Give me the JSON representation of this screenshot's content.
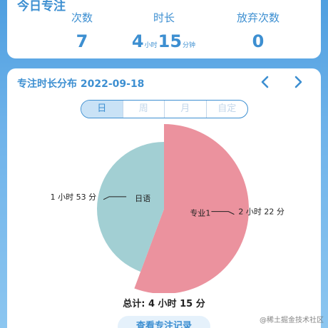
{
  "stats": {
    "title": "今日专注",
    "count_label": "次数",
    "count_value": "7",
    "duration_label": "时长",
    "duration_hours": "4",
    "duration_hours_unit": "小时",
    "duration_minutes": "15",
    "duration_minutes_unit": "分钟",
    "abandon_label": "放弃次数",
    "abandon_value": "0"
  },
  "distribution": {
    "title": "专注时长分布 2022-09-18",
    "prev_icon": "chevron-left-icon",
    "next_icon": "chevron-right-icon",
    "tabs": [
      {
        "label": "日",
        "active": true
      },
      {
        "label": "周",
        "active": false
      },
      {
        "label": "月",
        "active": false
      },
      {
        "label": "自定",
        "active": false
      }
    ],
    "total_label": "总计: 4 小时 15 分",
    "view_records_label": "查看专注记录"
  },
  "chart_data": {
    "type": "pie",
    "rose": true,
    "slices": [
      {
        "name": "专业1",
        "value_minutes": 142,
        "value_label": "2 小时 22 分",
        "color": "#eb929e"
      },
      {
        "name": "日语",
        "value_minutes": 113,
        "value_label": "1 小时 53 分",
        "color": "#a2cfd3"
      }
    ],
    "start_angle_deg": 0,
    "direction": "clockwise"
  },
  "watermark": "@稀土掘金技术社区",
  "colors": {
    "accent": "#3d8fd1",
    "pink": "#eb929e",
    "teal": "#a2cfd3"
  }
}
